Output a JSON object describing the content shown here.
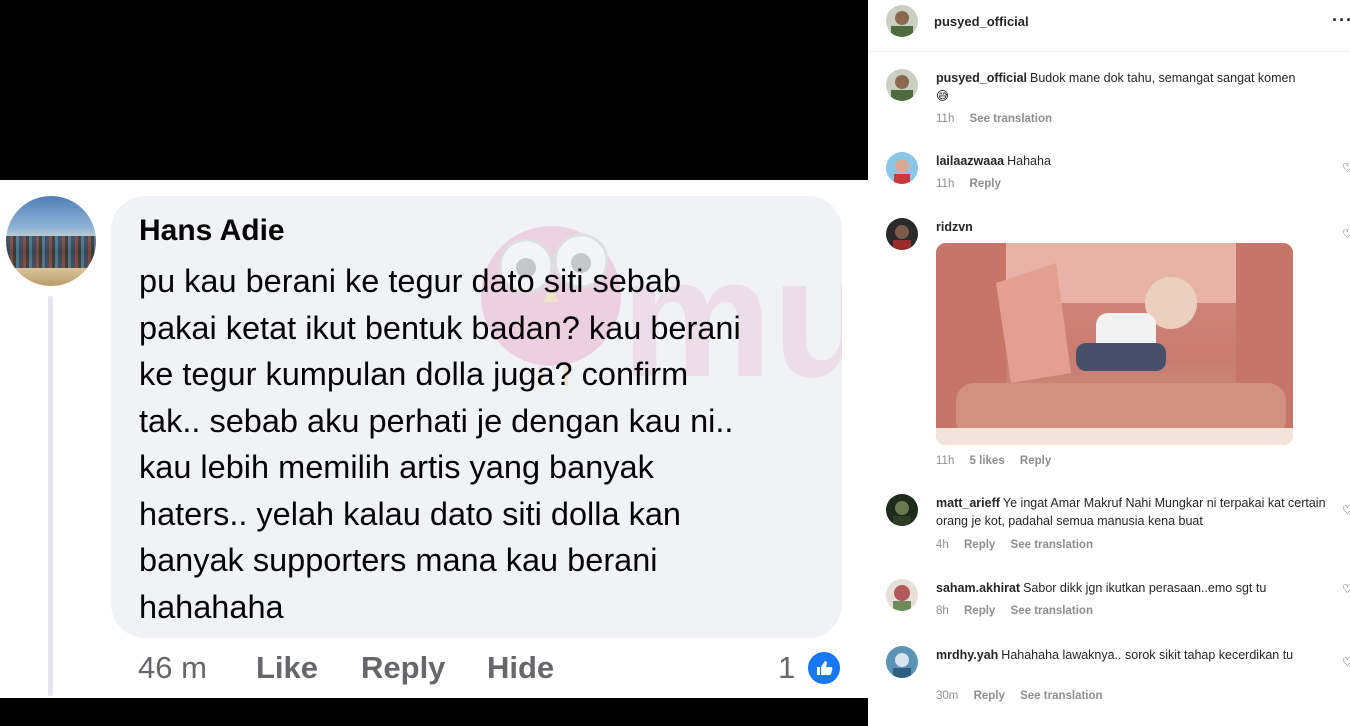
{
  "facebook_comment": {
    "author": "Hans Adie",
    "lines": [
      "pu kau berani ke tegur dato siti sebab",
      "pakai ketat ikut bentuk badan? kau berani",
      "ke tegur kumpulan dolla juga? confirm",
      "tak.. sebab aku perhati je dengan kau ni..",
      "kau lebih memilih artis yang banyak",
      "haters.. yelah kalau dato siti dolla kan",
      "banyak supporters mana kau berani",
      "hahahaha"
    ],
    "time": "46 m",
    "like_label": "Like",
    "reply_label": "Reply",
    "hide_label": "Hide",
    "reaction_count": "1",
    "reaction_icon": "thumbs-up-icon"
  },
  "watermark": {
    "text": "mur",
    "icon": "owl-mascot-icon"
  },
  "instagram": {
    "header": {
      "username": "pusyed_official",
      "more_icon": "more-horizontal-icon",
      "more_label": "···"
    },
    "comments": [
      {
        "username": "pusyed_official",
        "text": "Budok mane dok tahu, semangat sangat komen",
        "emoji": "😅",
        "time": "11h",
        "actions": [
          "See translation"
        ]
      },
      {
        "username": "lailaazwaaa",
        "text": "Hahaha",
        "time": "11h",
        "actions": [
          "Reply"
        ]
      },
      {
        "username": "ridzvn",
        "text": "",
        "time": "11h",
        "likes": "5 likes",
        "actions": [
          "Reply"
        ]
      },
      {
        "username": "matt_arieff",
        "text": "Ye ingat Amar Makruf Nahi Mungkar ni terpakai kat certain orang je kot, padahal semua manusia kena buat",
        "time": "4h",
        "actions": [
          "Reply",
          "See translation"
        ]
      },
      {
        "username": "saham.akhirat",
        "text": "Sabor dikk jgn ikutkan perasaan..emo sgt tu",
        "time": "8h",
        "actions": [
          "Reply",
          "See translation"
        ]
      },
      {
        "username": "mrdhy.yah",
        "text": "Hahahaha lawaknya.. sorok sikit tahap kecerdikan tu",
        "time": "30m",
        "actions": [
          "Reply",
          "See translation"
        ]
      }
    ],
    "heart_icon": "heart-outline-icon",
    "colors": {
      "text": "#262626",
      "meta": "#8e8e8e"
    }
  },
  "colors": {
    "fb_like_blue": "#1877f2",
    "fb_bubble": "#f0f2f5",
    "fb_meta": "#65676b"
  }
}
